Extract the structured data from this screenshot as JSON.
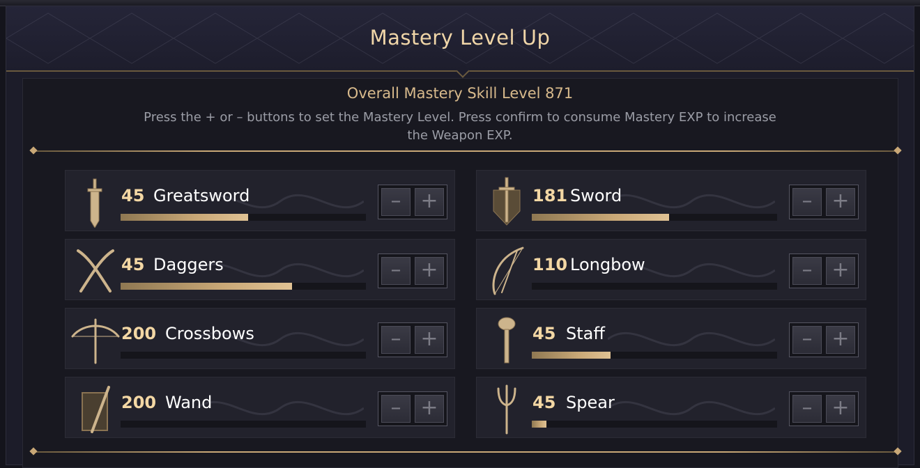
{
  "header": {
    "title": "Mastery Level Up"
  },
  "summary": {
    "overall": "Overall Mastery Skill Level 871",
    "instructions": "Press the + or – buttons to set the Mastery Level. Press confirm to consume Mastery EXP to increase the Weapon EXP."
  },
  "controls": {
    "minus_label": "–",
    "plus_label": "+"
  },
  "weapons": [
    {
      "level": "45",
      "name": "Greatsword",
      "progress": 0.52,
      "icon": "greatsword-icon"
    },
    {
      "level": "181",
      "name": "Sword",
      "progress": 0.56,
      "icon": "sword-shield-icon"
    },
    {
      "level": "45",
      "name": "Daggers",
      "progress": 0.7,
      "icon": "daggers-icon"
    },
    {
      "level": "110",
      "name": "Longbow",
      "progress": 0.0,
      "icon": "longbow-icon"
    },
    {
      "level": "200",
      "name": "Crossbows",
      "progress": 0.0,
      "icon": "crossbow-icon"
    },
    {
      "level": "45",
      "name": "Staff",
      "progress": 0.32,
      "icon": "staff-icon"
    },
    {
      "level": "200",
      "name": "Wand",
      "progress": 0.0,
      "icon": "wand-icon"
    },
    {
      "level": "45",
      "name": "Spear",
      "progress": 0.06,
      "icon": "spear-icon"
    }
  ],
  "colors": {
    "accent_gold": "#c9a877",
    "title_text": "#f0d6a8",
    "level_text": "#f3d7a4",
    "background": "#1c1c29"
  }
}
